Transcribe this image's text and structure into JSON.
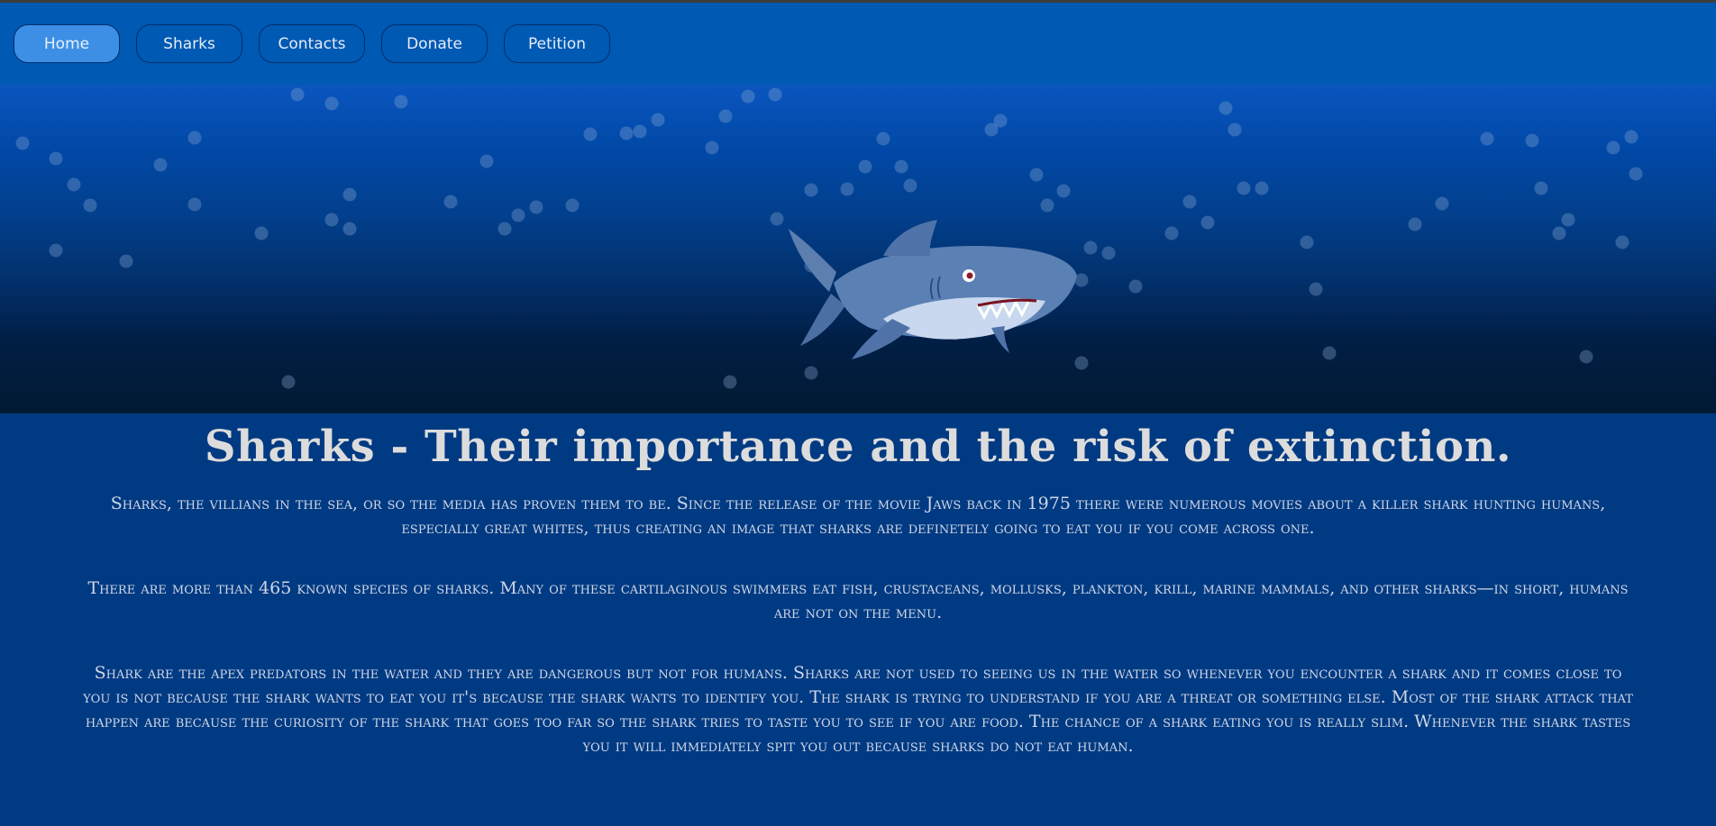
{
  "nav": {
    "items": [
      {
        "label": "Home",
        "active": true
      },
      {
        "label": "Sharks"
      },
      {
        "label": "Contacts"
      },
      {
        "label": "Donate"
      },
      {
        "label": "Petition"
      }
    ]
  },
  "hero": {
    "image": "cartoon-shark-illustration"
  },
  "main": {
    "title_strong": "Sharks",
    "title_rest": " - Their importance and the risk of extinction.",
    "paragraphs": [
      "Sharks, the villians in the sea, or so the media has proven them to be. Since the release of the movie Jaws back in 1975 there were numerous movies about a killer shark hunting humans, especially great whites, thus creating an image that sharks are definetely going to eat you if you come across one.",
      "There are more than 465 known species of sharks. Many of these cartilaginous swimmers eat fish, crustaceans, mollusks, plankton, krill, marine mammals, and other sharks—in short, humans are not on the menu.",
      "Shark are the apex predators in the water and they are dangerous but not for humans. Sharks are not used to seeing us in the water so whenever you encounter a shark and it comes close to you is not because the shark wants to eat you it's because the shark wants to identify you. The shark is trying to understand if you are a threat or something else. Most of the shark attack that happen are because the curiosity of the shark that goes too far so the shark tries to taste you to see if you are food. The chance of a shark eating you is really slim. Whenever the shark tastes you it will immediately spit you out because sharks do not eat human."
    ]
  },
  "colors": {
    "navbar": "#0059b3",
    "nav_active": "#3d8fe6",
    "page_bg": "#003a82",
    "text": "#cfd6e6"
  }
}
